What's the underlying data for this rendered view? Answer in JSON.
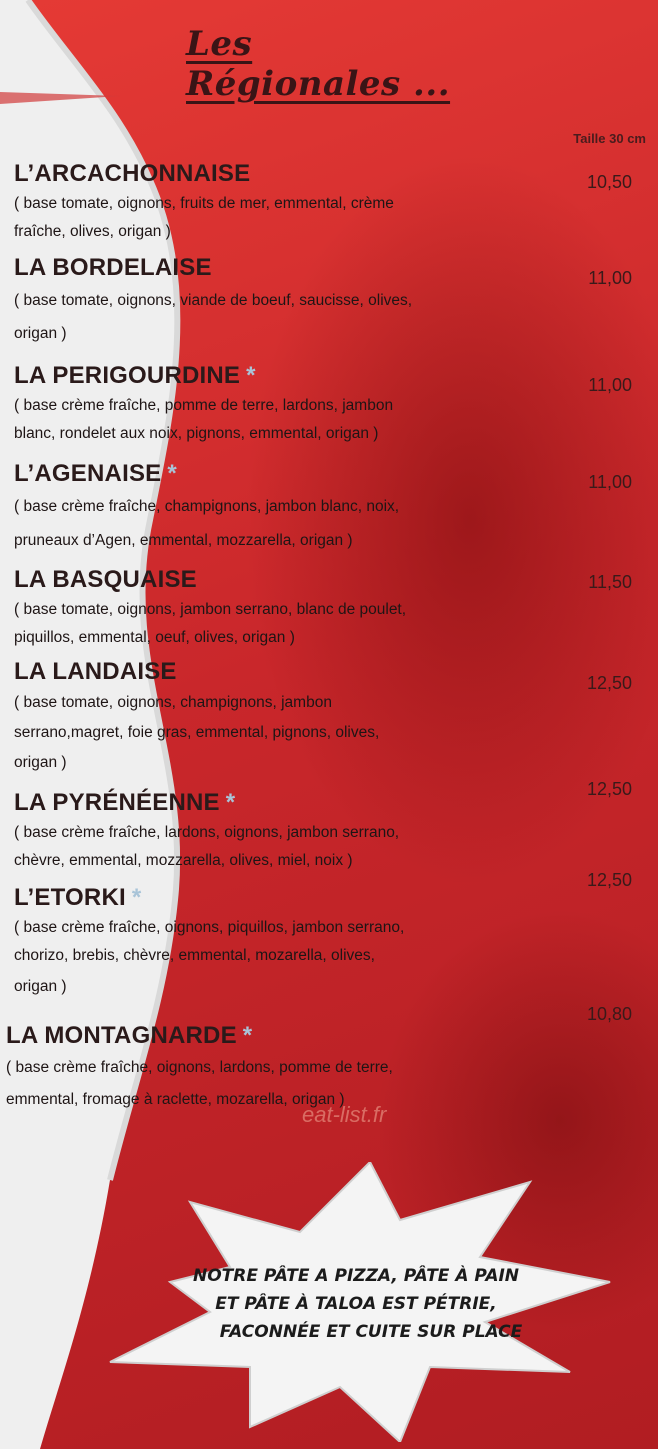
{
  "menu": {
    "title": "Les Régionales ...",
    "size_label": "Taille 30 cm",
    "items": [
      {
        "name": "L’ARCACHONNAISE",
        "star": "",
        "price": "10,50",
        "desc": [
          "( base tomate, oignons, fruits de mer, emmental, crème",
          "fraîche, olives, origan )"
        ]
      },
      {
        "name": "LA BORDELAISE",
        "star": "",
        "price": "11,00",
        "desc": [
          "( base tomate, oignons, viande de boeuf, saucisse, olives,",
          "origan )"
        ]
      },
      {
        "name": "LA PERIGOURDINE",
        "star": "*",
        "price": "11,00",
        "desc": [
          "( base crème fraîche, pomme de terre, lardons, jambon",
          "blanc, rondelet aux noix, pignons, emmental, origan )"
        ]
      },
      {
        "name": "L’AGENAISE",
        "star": "*",
        "price": "11,00",
        "desc": [
          "( base crème fraîche, champignons, jambon blanc, noix,",
          "pruneaux d’Agen, emmental, mozzarella, origan )"
        ]
      },
      {
        "name": "LA BASQUAISE",
        "star": "",
        "price": "11,50",
        "desc": [
          "( base tomate, oignons, jambon serrano, blanc de poulet,",
          "piquillos, emmental, oeuf,  olives, origan )"
        ]
      },
      {
        "name": "LA LANDAISE",
        "star": "",
        "price": "12,50",
        "desc": [
          "( base tomate, oignons, champignons,  jambon",
          "serrano,magret, foie gras, emmental, pignons, olives,",
          "origan )"
        ]
      },
      {
        "name": "LA PYRÉNÉENNE",
        "star": "*",
        "price": "12,50",
        "desc": [
          "( base crème fraîche, lardons, oignons, jambon serrano,",
          "chèvre, emmental, mozzarella,  olives, miel, noix )"
        ]
      },
      {
        "name": "L’ETORKI",
        "star": "*",
        "price": "12,50",
        "desc": [
          "( base crème fraîche, oignons, piquillos, jambon serrano,",
          "chorizo, brebis, chèvre, emmental, mozarella, olives,",
          "origan )"
        ]
      },
      {
        "name": "LA MONTAGNARDE",
        "star": "*",
        "price": "10,80",
        "desc": [
          "( base crème fraîche, oignons, lardons, pomme de terre,",
          "emmental, fromage à raclette, mozarella, origan )"
        ]
      }
    ]
  },
  "watermark": "eat-list.fr",
  "burst": {
    "lines": [
      "NOTRE PÂTE A PIZZA, PÂTE À PAIN",
      "ET PÂTE À TALOA EST PÉTRIE,",
      "FACONNÉE ET CUITE SUR PLACE"
    ]
  },
  "colors": {
    "background_red": "#c9272b",
    "swoosh_white": "#f1f1f1",
    "star_blue": "#a9c4d8"
  }
}
